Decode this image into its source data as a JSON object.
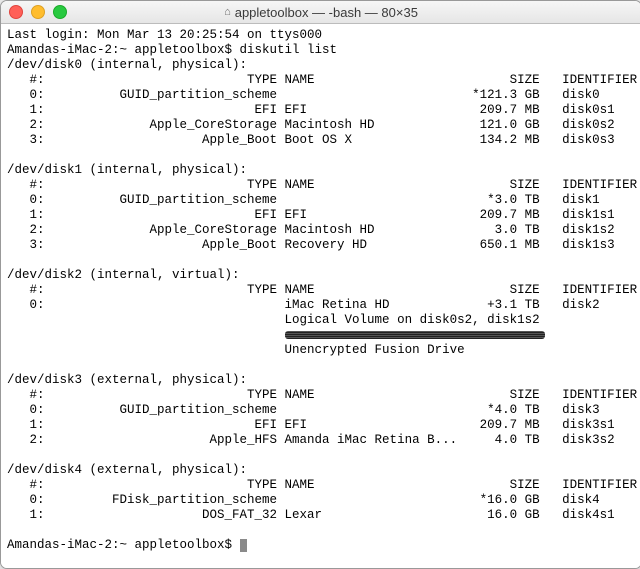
{
  "window": {
    "title": "appletoolbox — -bash — 80×35"
  },
  "session": {
    "last_login": "Last login: Mon Mar 13 20:25:54 on ttys000",
    "prompt_host": "Amandas-iMac-2:~",
    "prompt_user": "appletoolbox$",
    "command": "diskutil list"
  },
  "headers": {
    "num": "#:",
    "type": "TYPE",
    "name": "NAME",
    "size": "SIZE",
    "identifier": "IDENTIFIER"
  },
  "disks": [
    {
      "device": "/dev/disk0 (internal, physical):",
      "rows": [
        {
          "n": "0:",
          "type": "GUID_partition_scheme",
          "name": "",
          "size": "*121.3 GB",
          "id": "disk0"
        },
        {
          "n": "1:",
          "type": "EFI",
          "name": "EFI",
          "size": "209.7 MB",
          "id": "disk0s1"
        },
        {
          "n": "2:",
          "type": "Apple_CoreStorage",
          "name": "Macintosh HD",
          "size": "121.0 GB",
          "id": "disk0s2"
        },
        {
          "n": "3:",
          "type": "Apple_Boot",
          "name": "Boot OS X",
          "size": "134.2 MB",
          "id": "disk0s3"
        }
      ]
    },
    {
      "device": "/dev/disk1 (internal, physical):",
      "rows": [
        {
          "n": "0:",
          "type": "GUID_partition_scheme",
          "name": "",
          "size": "*3.0 TB",
          "id": "disk1"
        },
        {
          "n": "1:",
          "type": "EFI",
          "name": "EFI",
          "size": "209.7 MB",
          "id": "disk1s1"
        },
        {
          "n": "2:",
          "type": "Apple_CoreStorage",
          "name": "Macintosh HD",
          "size": "3.0 TB",
          "id": "disk1s2"
        },
        {
          "n": "3:",
          "type": "Apple_Boot",
          "name": "Recovery HD",
          "size": "650.1 MB",
          "id": "disk1s3"
        }
      ]
    },
    {
      "device": "/dev/disk2 (internal, virtual):",
      "rows": [
        {
          "n": "0:",
          "type": "",
          "name": "iMac Retina HD",
          "size": "+3.1 TB",
          "id": "disk2"
        }
      ],
      "extra": [
        "Logical Volume on disk0s2, disk1s2",
        "__SCRUBBED__",
        "Unencrypted Fusion Drive"
      ]
    },
    {
      "device": "/dev/disk3 (external, physical):",
      "rows": [
        {
          "n": "0:",
          "type": "GUID_partition_scheme",
          "name": "",
          "size": "*4.0 TB",
          "id": "disk3"
        },
        {
          "n": "1:",
          "type": "EFI",
          "name": "EFI",
          "size": "209.7 MB",
          "id": "disk3s1"
        },
        {
          "n": "2:",
          "type": "Apple_HFS",
          "name": "Amanda iMac Retina B...",
          "size": "4.0 TB",
          "id": "disk3s2"
        }
      ]
    },
    {
      "device": "/dev/disk4 (external, physical):",
      "rows": [
        {
          "n": "0:",
          "type": "FDisk_partition_scheme",
          "name": "",
          "size": "*16.0 GB",
          "id": "disk4"
        },
        {
          "n": "1:",
          "type": "DOS_FAT_32",
          "name": "Lexar",
          "size": "16.0 GB",
          "id": "disk4s1"
        }
      ]
    }
  ]
}
